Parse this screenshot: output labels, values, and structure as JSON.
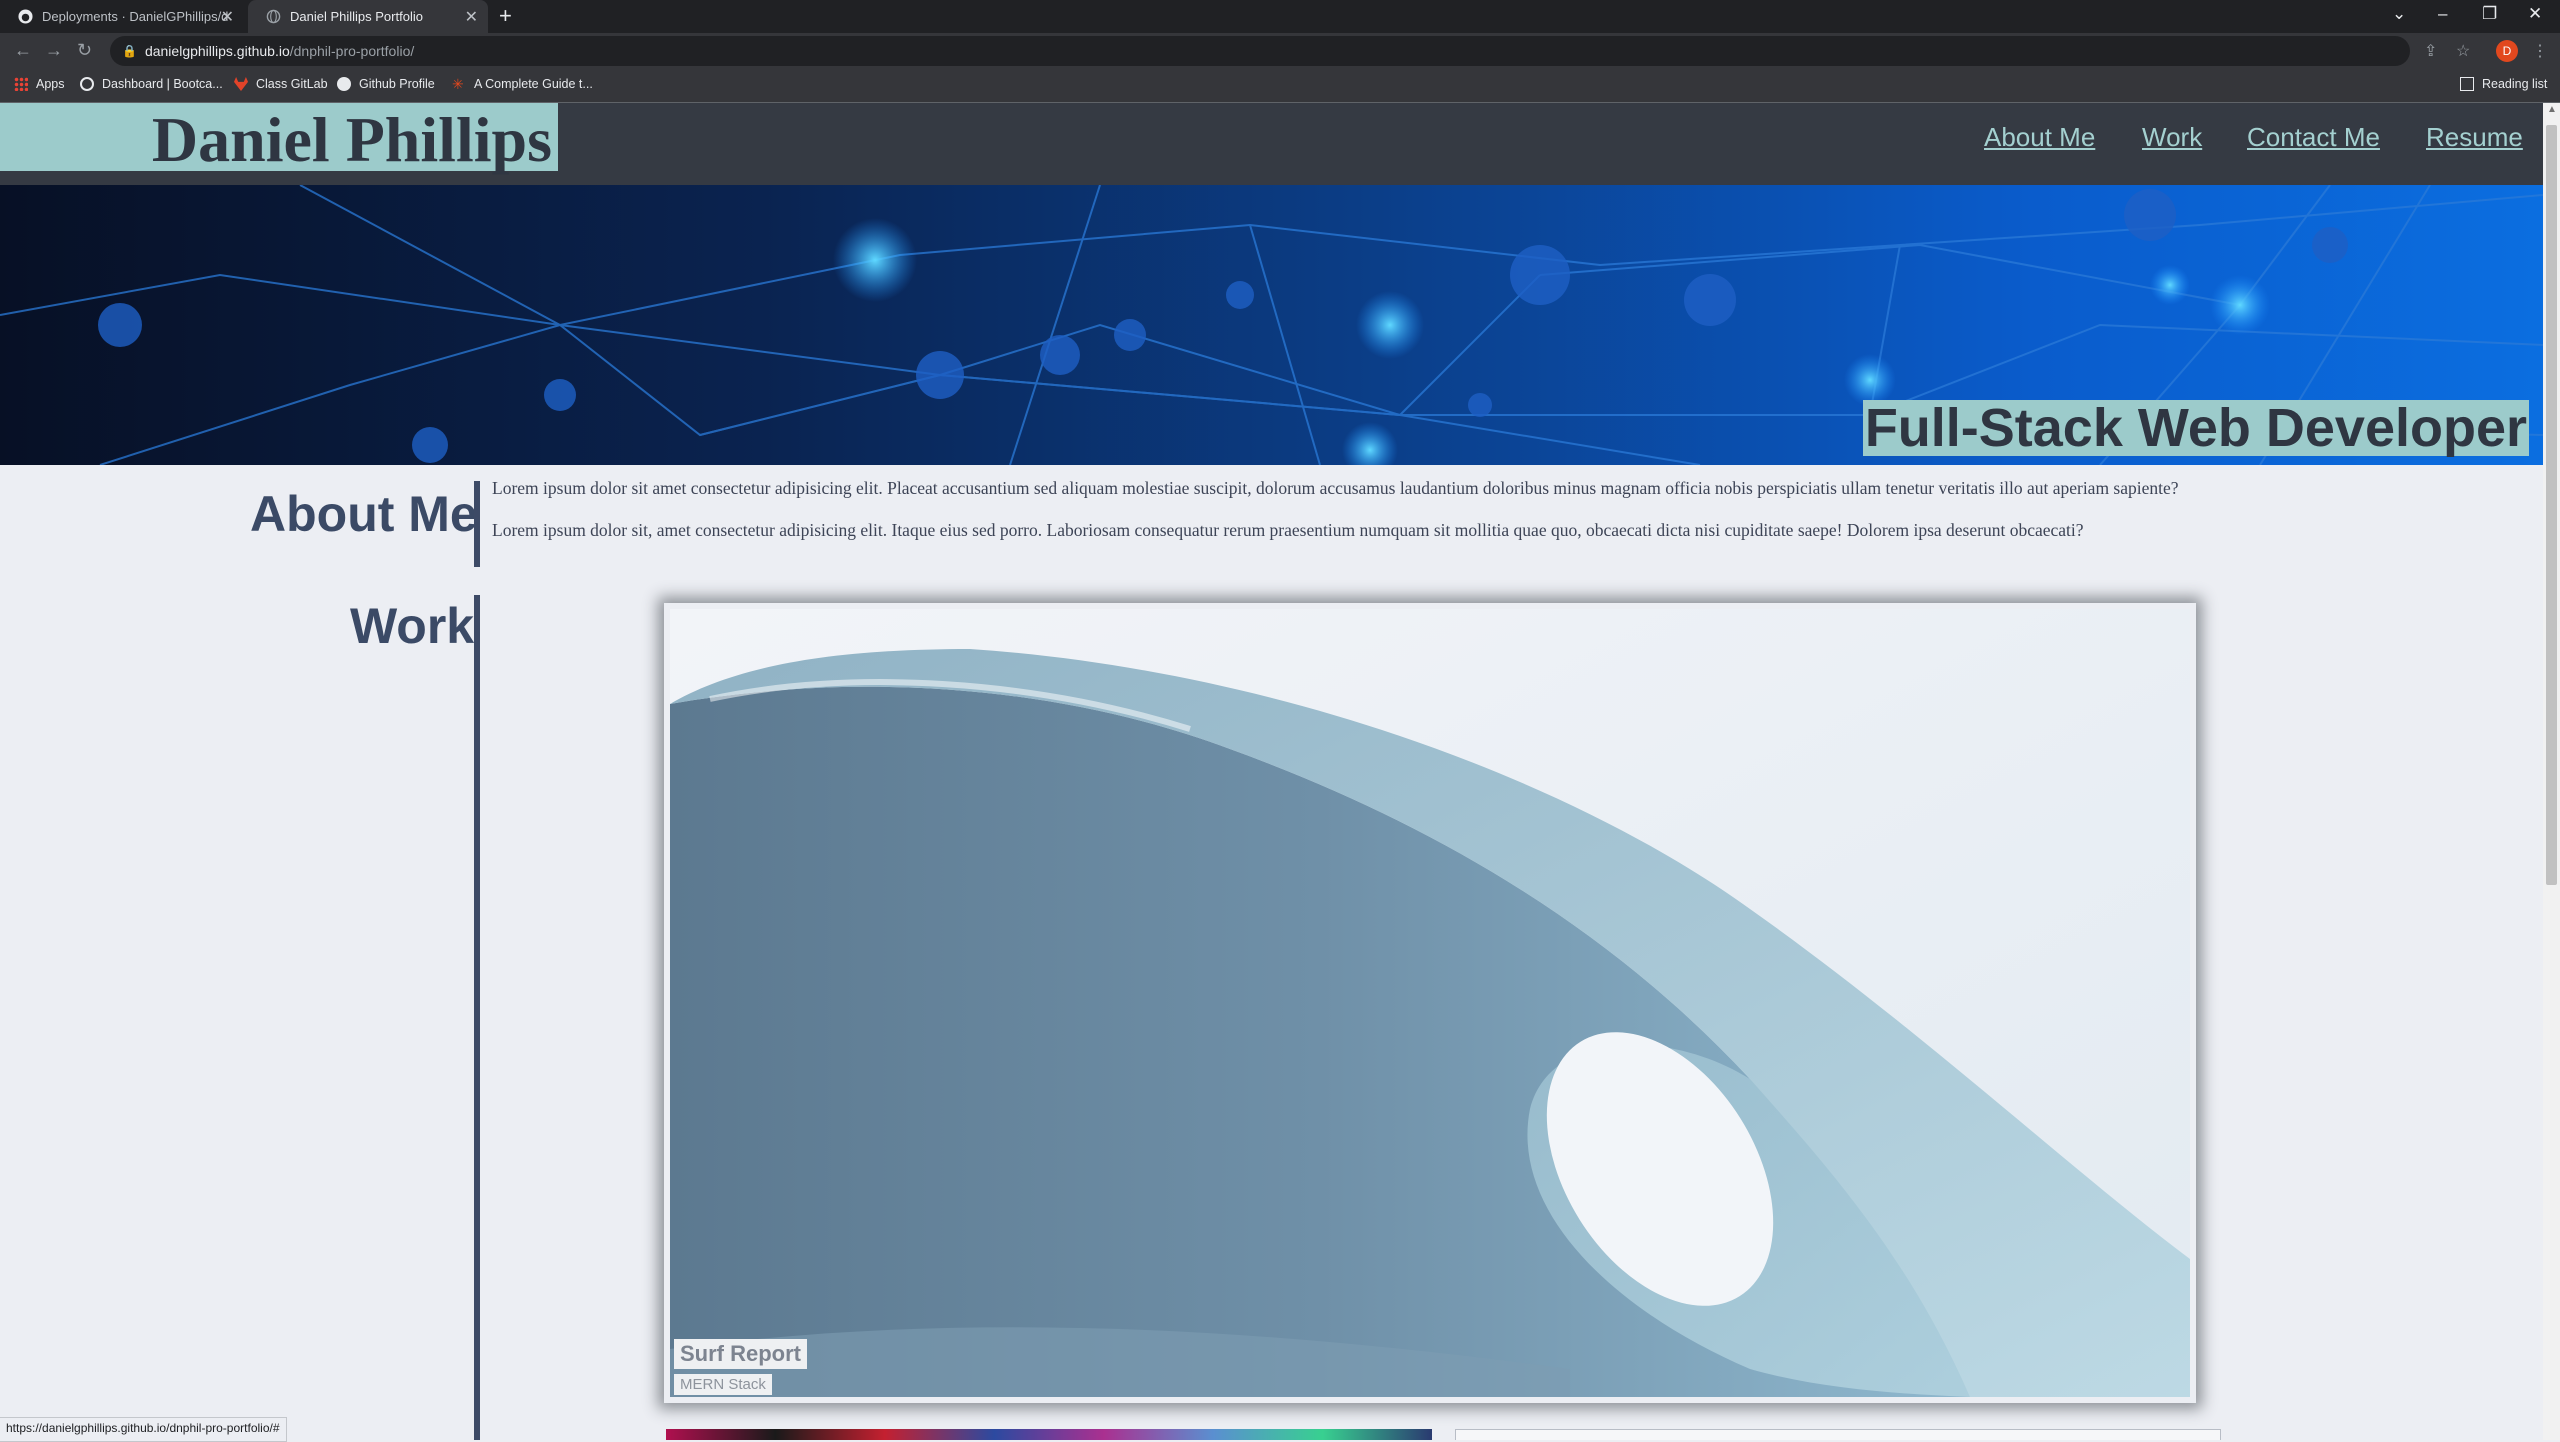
{
  "browser": {
    "tabs": [
      {
        "title": "Deployments · DanielGPhillips/d",
        "favicon": "github-icon"
      },
      {
        "title": "Daniel Phillips Portfolio",
        "favicon": "globe-icon"
      }
    ],
    "url_host": "danielgphillips.github.io",
    "url_path": "/dnphil-pro-portfolio/",
    "profile_initial": "D",
    "bookmarks": [
      {
        "label": "Apps",
        "icon": "apps-grid-icon"
      },
      {
        "label": "Dashboard | Bootca...",
        "icon": "dashboard-icon"
      },
      {
        "label": "Class GitLab",
        "icon": "gitlab-icon"
      },
      {
        "label": "Github Profile",
        "icon": "github-icon"
      },
      {
        "label": "A Complete Guide t...",
        "icon": "asterisk-icon"
      }
    ],
    "reading_list": "Reading list",
    "status_url": "https://danielgphillips.github.io/dnphil-pro-portfolio/#"
  },
  "site": {
    "name": "Daniel Phillips",
    "nav": [
      "About Me",
      "Work",
      "Contact Me",
      "Resume"
    ],
    "tagline": "Full-Stack Web Developer"
  },
  "about": {
    "heading": "About Me",
    "paragraphs": [
      "Lorem ipsum dolor sit amet consectetur adipisicing elit. Placeat accusantium sed aliquam molestiae suscipit, dolorum accusamus laudantium doloribus minus magnam officia nobis perspiciatis ullam tenetur veritatis illo aut aperiam sapiente?",
      "Lorem ipsum dolor sit, amet consectetur adipisicing elit. Itaque eius sed porro. Laboriosam consequatur rerum praesentium numquam sit mollitia quae quo, obcaecati dicta nisi cupiditate saepe! Dolorem ipsa deserunt obcaecati?"
    ]
  },
  "work": {
    "heading": "Work",
    "projects": [
      {
        "title": "Surf Report",
        "subtitle": "MERN Stack"
      }
    ]
  },
  "colors": {
    "accent": "#9ccbcb",
    "header_bg": "#353a43",
    "text_dark": "#3b4a66",
    "page_bg": "#eceef3"
  }
}
